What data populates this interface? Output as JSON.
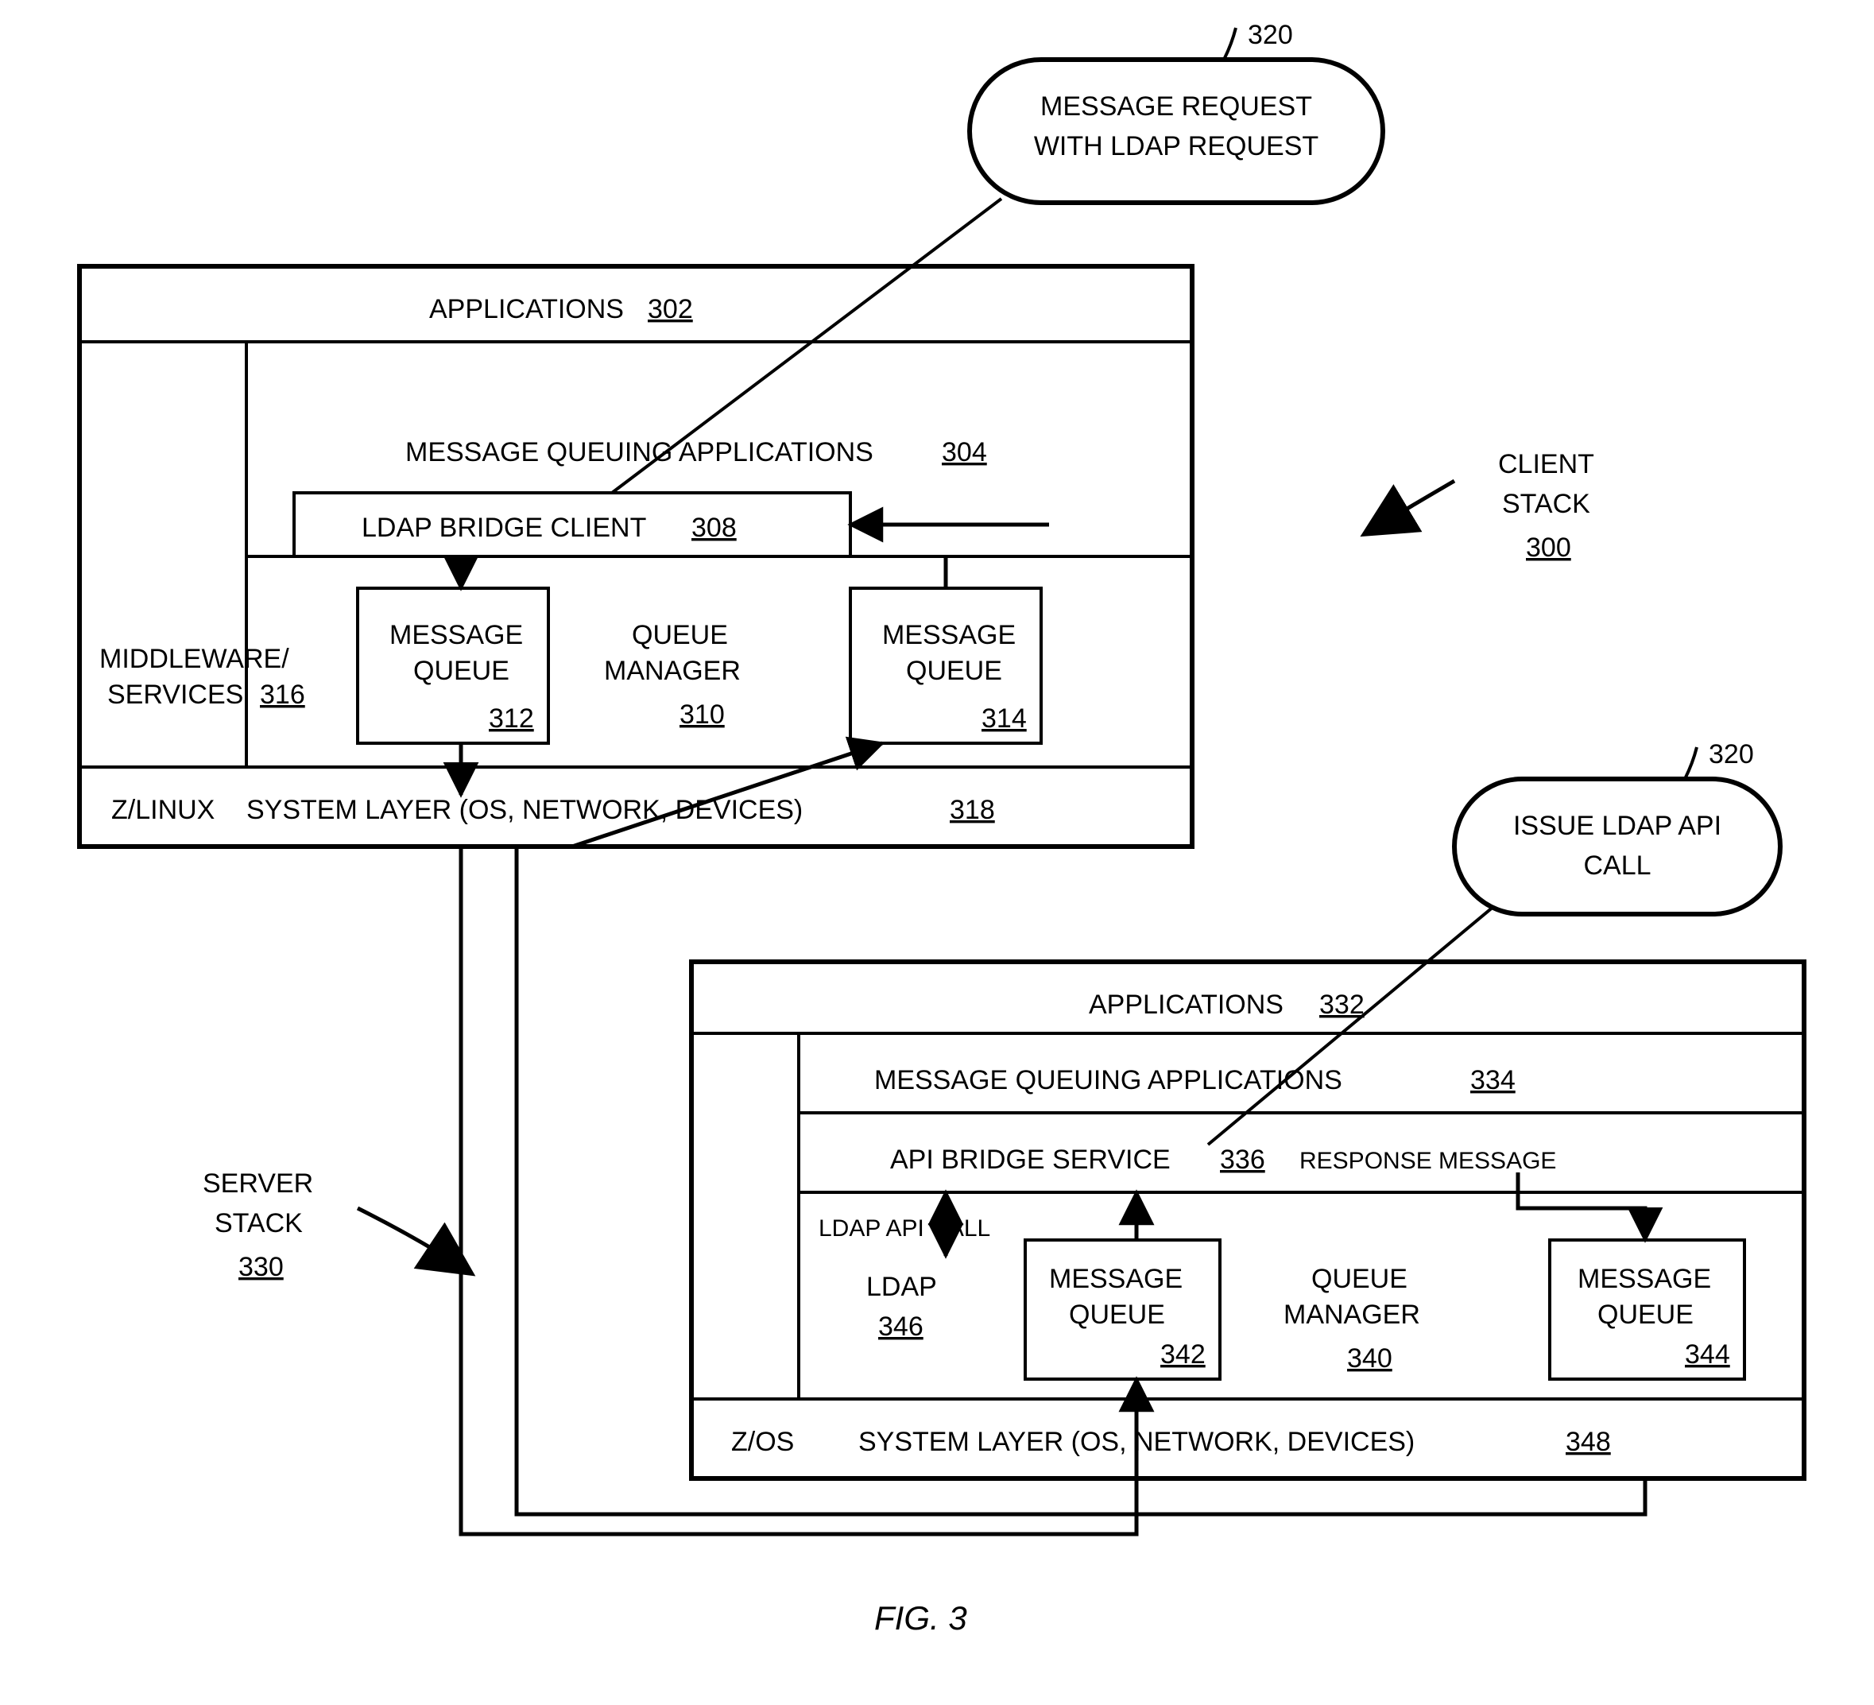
{
  "figureCaption": "FIG. 3",
  "client": {
    "label": "CLIENT STACK",
    "num": "300",
    "apps": {
      "label": "APPLICATIONS",
      "num": "302"
    },
    "mq": {
      "label": "MESSAGE QUEUING APPLICATIONS",
      "num": "304"
    },
    "bridge": {
      "label": "LDAP BRIDGE CLIENT",
      "num": "308"
    },
    "middleware": {
      "label1": "MIDDLEWARE/",
      "label2": "SERVICES",
      "num": "316"
    },
    "qm": {
      "label1": "QUEUE",
      "label2": "MANAGER",
      "num": "310"
    },
    "mqueue1": {
      "label1": "MESSAGE",
      "label2": "QUEUE",
      "num": "312"
    },
    "mqueue2": {
      "label1": "MESSAGE",
      "label2": "QUEUE",
      "num": "314"
    },
    "system": {
      "prefix": "Z/LINUX",
      "label": "SYSTEM LAYER (OS, NETWORK, DEVICES)",
      "num": "318"
    }
  },
  "server": {
    "label": "SERVER STACK",
    "num": "330",
    "apps": {
      "label": "APPLICATIONS",
      "num": "332"
    },
    "mq": {
      "label": "MESSAGE QUEUING APPLICATIONS",
      "num": "334"
    },
    "bridge": {
      "label": "API BRIDGE SERVICE",
      "num": "336"
    },
    "response": "RESPONSE MESSAGE",
    "ldapCall": "LDAP API CALL",
    "ldap": {
      "label": "LDAP",
      "num": "346"
    },
    "qm": {
      "label1": "QUEUE",
      "label2": "MANAGER",
      "num": "340"
    },
    "mqueue1": {
      "label1": "MESSAGE",
      "label2": "QUEUE",
      "num": "342"
    },
    "mqueue2": {
      "label1": "MESSAGE",
      "label2": "QUEUE",
      "num": "344"
    },
    "system": {
      "prefix": "Z/OS",
      "label": "SYSTEM LAYER (OS, NETWORK, DEVICES)",
      "num": "348"
    }
  },
  "callouts": {
    "msgRequest": {
      "line1": "MESSAGE REQUEST",
      "line2": "WITH LDAP REQUEST",
      "num": "320"
    },
    "issueCall": {
      "line1": "ISSUE LDAP API",
      "line2": "CALL",
      "num": "320"
    }
  }
}
